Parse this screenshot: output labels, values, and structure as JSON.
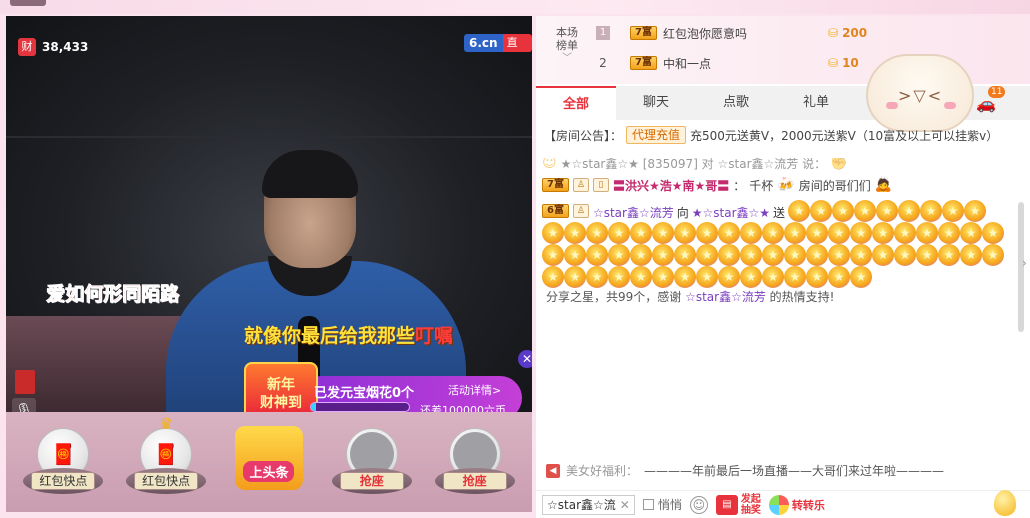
{
  "live": {
    "viewer_count": "38,433",
    "viewer_badge": "财",
    "site": "6.cn",
    "live_label": "直播",
    "lyric_line1": "爱如何形同陌路",
    "lyric_line2_main": "就像你最后给我那些",
    "lyric_line2_highlight": "叮嘱"
  },
  "promo": {
    "seal_line1": "新年",
    "seal_line2": "财神到",
    "message": "已发元宝烟花0个",
    "detail_link": "活动详情>",
    "progress": 0.05,
    "goal_text": "还差100000六币"
  },
  "seats": [
    {
      "label": "红包快点",
      "type": "gift"
    },
    {
      "label": "红包快点",
      "type": "gift-crown"
    },
    {
      "label": "上头条",
      "type": "headline"
    },
    {
      "label": "抢座",
      "type": "empty"
    },
    {
      "label": "抢座",
      "type": "empty"
    }
  ],
  "ranking": {
    "title_line1": "本场",
    "title_line2": "榜单",
    "rows": [
      {
        "rank": "1",
        "level": "7富",
        "name": "红包泡你愿意吗",
        "score": "200"
      },
      {
        "rank": "2",
        "level": "7富",
        "name": "中和一点",
        "score": "10"
      }
    ]
  },
  "tabs": [
    {
      "label": "全部",
      "active": true
    },
    {
      "label": "聊天",
      "active": false
    },
    {
      "label": "点歌",
      "active": false
    },
    {
      "label": "礼单",
      "active": false
    }
  ],
  "car_badge": "11",
  "notice": {
    "prefix": "【房间公告】：",
    "agent_label": "代理充值",
    "text": "充500元送黄V，2000元送紫V（10富及以上可以挂紫v）"
  },
  "chat": {
    "faded_line": "★☆star鑫☆★ [835097] 对 ☆star鑫☆流芳 说：",
    "line2": {
      "level": "7富",
      "name": "〓洪兴★浩★南★哥〓",
      "sep": "：",
      "text_a": "千杯",
      "text_b": "房间的哥们们"
    },
    "gift": {
      "level": "6富",
      "from": "☆star鑫☆流芳",
      "to_word": "向",
      "to": "★☆star鑫☆★",
      "send": "送",
      "tail": "分享之星，共99个，感谢",
      "thank_name": "☆star鑫☆流芳",
      "support": "的热情支持!",
      "star_count": 99
    }
  },
  "welfare": {
    "label": "美女好福利：",
    "text": "————年前最后一场直播——大哥们来过年啦————"
  },
  "input": {
    "target": "☆star鑫☆流",
    "quiet_label": "悄悄",
    "lottery_line1": "发起",
    "lottery_line2": "抽奖",
    "spin_label": "转转乐"
  },
  "colors": {
    "accent": "#e8333c",
    "brand": "#2e63c7"
  }
}
